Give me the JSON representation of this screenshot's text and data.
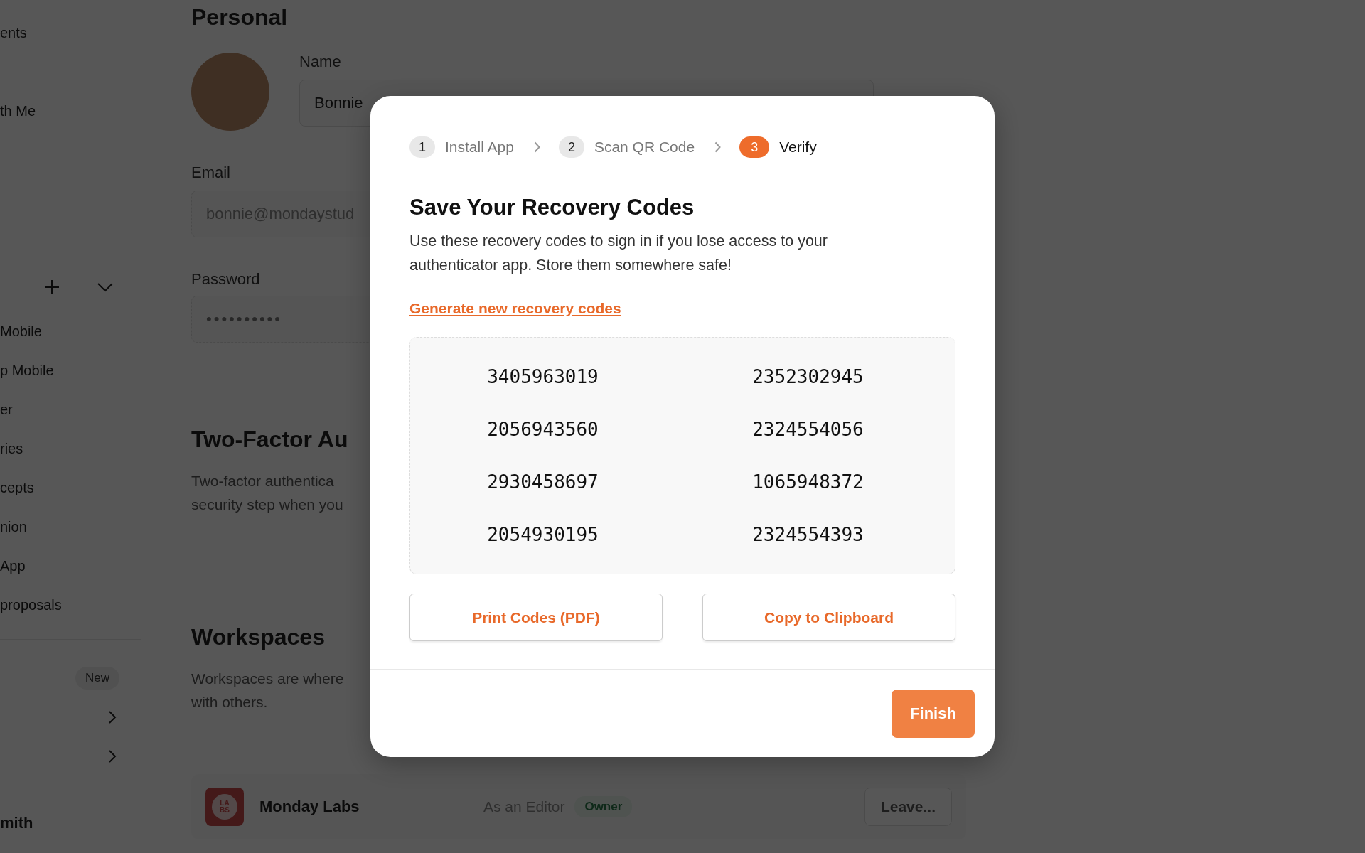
{
  "sidebar": {
    "top_items": [
      "ents",
      "th Me"
    ],
    "items": [
      "Mobile",
      "p Mobile",
      "er",
      "ries",
      "cepts",
      "nion",
      "App",
      "proposals"
    ],
    "extra_rows": [
      {
        "kind": "badge",
        "text": "New"
      },
      {
        "kind": "chevron"
      },
      {
        "kind": "chevron"
      }
    ],
    "user": "mith"
  },
  "personal": {
    "heading": "Personal",
    "name_label": "Name",
    "name_value": "Bonnie",
    "email_label": "Email",
    "email_value": "bonnie@mondaystud",
    "password_label": "Password",
    "password_value": "••••••••••"
  },
  "two_factor": {
    "heading": "Two-Factor Au",
    "description": [
      "Two-factor authentica",
      "security step when you"
    ]
  },
  "workspaces": {
    "heading": "Workspaces",
    "description": [
      "Workspaces are where",
      "with others."
    ],
    "rows": [
      {
        "logo_text": [
          "LA",
          "BS"
        ],
        "name": "Monday Labs",
        "role": "As an Editor",
        "badge": "Owner",
        "action": "Leave..."
      }
    ]
  },
  "modal": {
    "steps": [
      {
        "number": "1",
        "label": "Install App",
        "selected": false
      },
      {
        "number": "2",
        "label": "Scan QR Code",
        "selected": false
      },
      {
        "number": "3",
        "label": "Verify",
        "selected": true
      }
    ],
    "title": "Save Your Recovery Codes",
    "description": "Use these recovery codes to sign in if you lose access to your authenticator app. Store them somewhere safe!",
    "link": "Generate new recovery codes",
    "codes": [
      "3405963019",
      "2352302945",
      "2056943560",
      "2324554056",
      "2930458697",
      "1065948372",
      "2054930195",
      "2324554393"
    ],
    "buttons": [
      "Print Codes (PDF)",
      "Copy to Clipboard"
    ],
    "finish": "Finish"
  }
}
